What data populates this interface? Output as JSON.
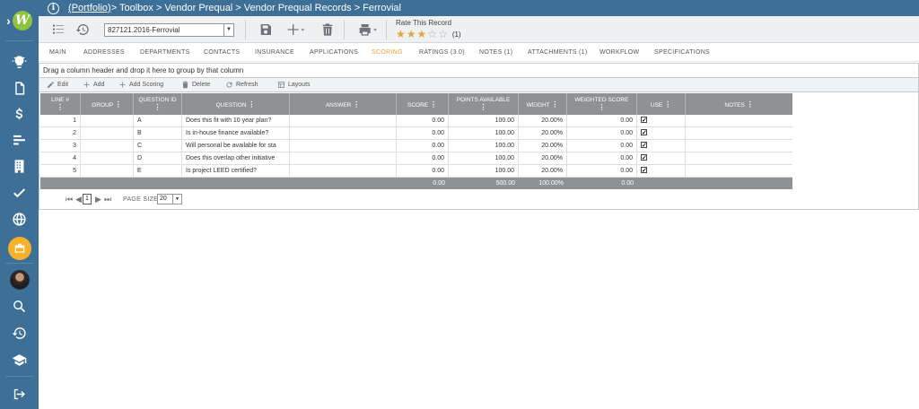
{
  "breadcrumb": {
    "portfolio_link": "(Portfolio)",
    "path": " > Toolbox > Vendor Prequal > Vendor Prequal Records > Ferrovial"
  },
  "toolbar": {
    "record_select_value": "827121.2016-Ferrovial",
    "rate_label": "Rate This Record",
    "rating_stars_filled": 3,
    "rating_stars_total": 5,
    "rating_count": "(1)"
  },
  "tabs": [
    {
      "label": "MAIN"
    },
    {
      "label": "ADDRESSES"
    },
    {
      "label": "DEPARTMENTS"
    },
    {
      "label": "CONTACTS"
    },
    {
      "label": "INSURANCE"
    },
    {
      "label": "APPLICATIONS"
    },
    {
      "label": "SCORING"
    },
    {
      "label": "RATINGS (3.0)"
    },
    {
      "label": "NOTES (1)"
    },
    {
      "label": "ATTACHMENTS (1)"
    },
    {
      "label": "WORKFLOW"
    },
    {
      "label": "SPECIFICATIONS"
    }
  ],
  "active_tab": "SCORING",
  "grid": {
    "group_hint": "Drag a column header and drop it here to group by that column",
    "actions": {
      "edit": "Edit",
      "add": "Add",
      "add_scoring": "Add Scoring",
      "delete": "Delete",
      "refresh": "Refresh",
      "layouts": "Layouts"
    },
    "columns": {
      "line": "LINE #",
      "group": "GROUP",
      "question_id": "QUESTION ID",
      "question": "QUESTION",
      "answer": "ANSWER",
      "score": "SCORE",
      "points_available": "POINTS AVAILABLE",
      "weight": "WEIGHT",
      "weighted_score": "WEIGHTED SCORE",
      "use": "USE",
      "notes": "NOTES"
    },
    "rows": [
      {
        "line": "1",
        "group": "",
        "question_id": "A",
        "question": "Does this fit with 10 year plan?",
        "answer": "",
        "score": "0.00",
        "points": "100.00",
        "weight": "20.00%",
        "weighted": "0.00",
        "use": true,
        "notes": ""
      },
      {
        "line": "2",
        "group": "",
        "question_id": "B",
        "question": "Is in-house finance available?",
        "answer": "",
        "score": "0.00",
        "points": "100.00",
        "weight": "20.00%",
        "weighted": "0.00",
        "use": true,
        "notes": ""
      },
      {
        "line": "3",
        "group": "",
        "question_id": "C",
        "question": "Will personal be available for sta",
        "answer": "",
        "score": "0.00",
        "points": "100.00",
        "weight": "20.00%",
        "weighted": "0.00",
        "use": true,
        "notes": ""
      },
      {
        "line": "4",
        "group": "",
        "question_id": "D",
        "question": "Does this overlap other initiative",
        "answer": "",
        "score": "0.00",
        "points": "100.00",
        "weight": "20.00%",
        "weighted": "0.00",
        "use": true,
        "notes": ""
      },
      {
        "line": "5",
        "group": "",
        "question_id": "E",
        "question": "Is project LEED certified?",
        "answer": "",
        "score": "0.00",
        "points": "100.00",
        "weight": "20.00%",
        "weighted": "0.00",
        "use": true,
        "notes": ""
      }
    ],
    "totals": {
      "score": "0.00",
      "points": "500.00",
      "weight": "100.00%",
      "weighted": "0.00"
    },
    "pager": {
      "current_page": "1",
      "page_size_label": "PAGE SIZE",
      "page_size": "20"
    }
  },
  "colors": {
    "sidebar": "#3d6f97",
    "active_tab": "#e3a23a",
    "grid_header": "#8f9295",
    "active_nav": "#f5b12a"
  }
}
